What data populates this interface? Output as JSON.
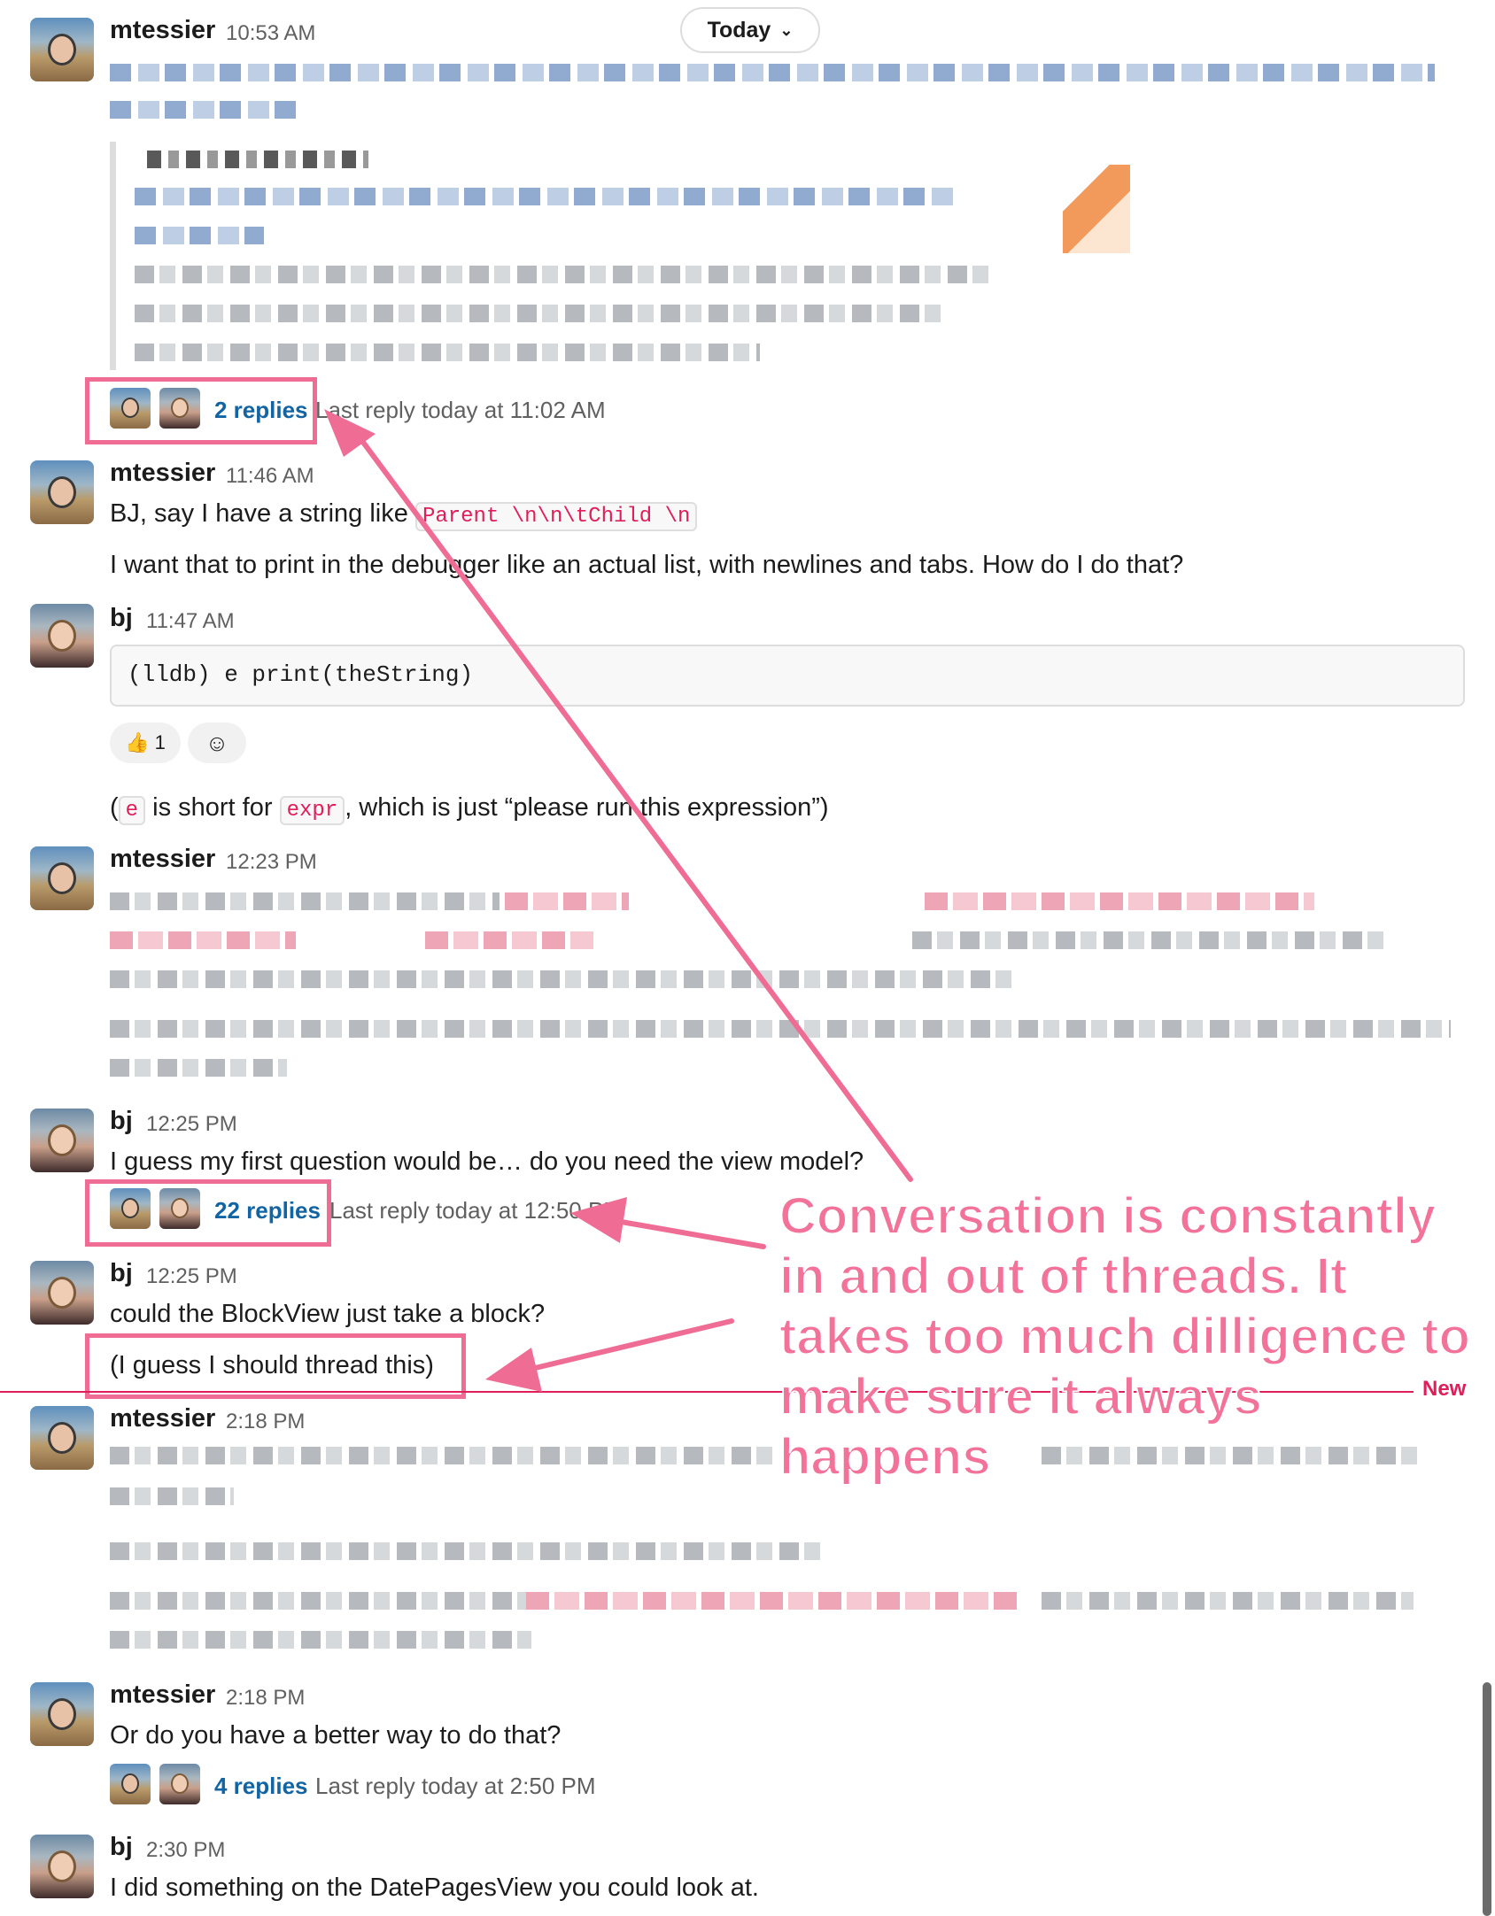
{
  "date_divider": {
    "label": "Today"
  },
  "messages": [
    {
      "author": "mtessier",
      "time": "10:53 AM",
      "replies": "2 replies",
      "last_reply": "Last reply today at 11:02 AM"
    },
    {
      "author": "mtessier",
      "time": "11:46 AM",
      "text_pre": "BJ, say I have a string like ",
      "code": "Parent \\n\\n\\tChild \\n",
      "text_2": "I want that to print in the debugger like an actual list, with newlines and tabs. How do I do that?"
    },
    {
      "author": "bj",
      "time": "11:47 AM",
      "codeblock": "(lldb) e print(theString)",
      "reaction_emoji": "👍",
      "reaction_count": "1",
      "text_open": "(",
      "code_e": "e",
      "text_mid": " is short for ",
      "code_expr": "expr",
      "text_end": ", which is just “please run this expression”)"
    },
    {
      "author": "mtessier",
      "time": "12:23 PM"
    },
    {
      "author": "bj",
      "time": "12:25 PM",
      "text": "I guess my first question would be… do you need the view model?",
      "replies": "22 replies",
      "last_reply": "Last reply today at 12:50 PM"
    },
    {
      "author": "bj",
      "time": "12:25 PM",
      "text": "could the BlockView just take a block?",
      "text_2": "(I guess I should thread this)"
    },
    {
      "author": "mtessier",
      "time": "2:18 PM"
    },
    {
      "author": "mtessier",
      "time": "2:18 PM",
      "text": "Or do you have a better way to do that?",
      "replies": "4 replies",
      "last_reply": "Last reply today at 2:50 PM"
    },
    {
      "author": "bj",
      "time": "2:30 PM",
      "text": "I did something on the DatePagesView you could look at."
    }
  ],
  "new_divider": {
    "label": "New"
  },
  "annotation": {
    "text": "Conversation is constantly\nin and out of threads. It\ntakes too much dilligence to\nmake sure it always\nhappens",
    "color": "#f2729a"
  },
  "colors": {
    "link": "#1264a3",
    "code_text": "#e01e5a",
    "new_line": "#e01e5a",
    "highlight": "#ef6d94"
  }
}
